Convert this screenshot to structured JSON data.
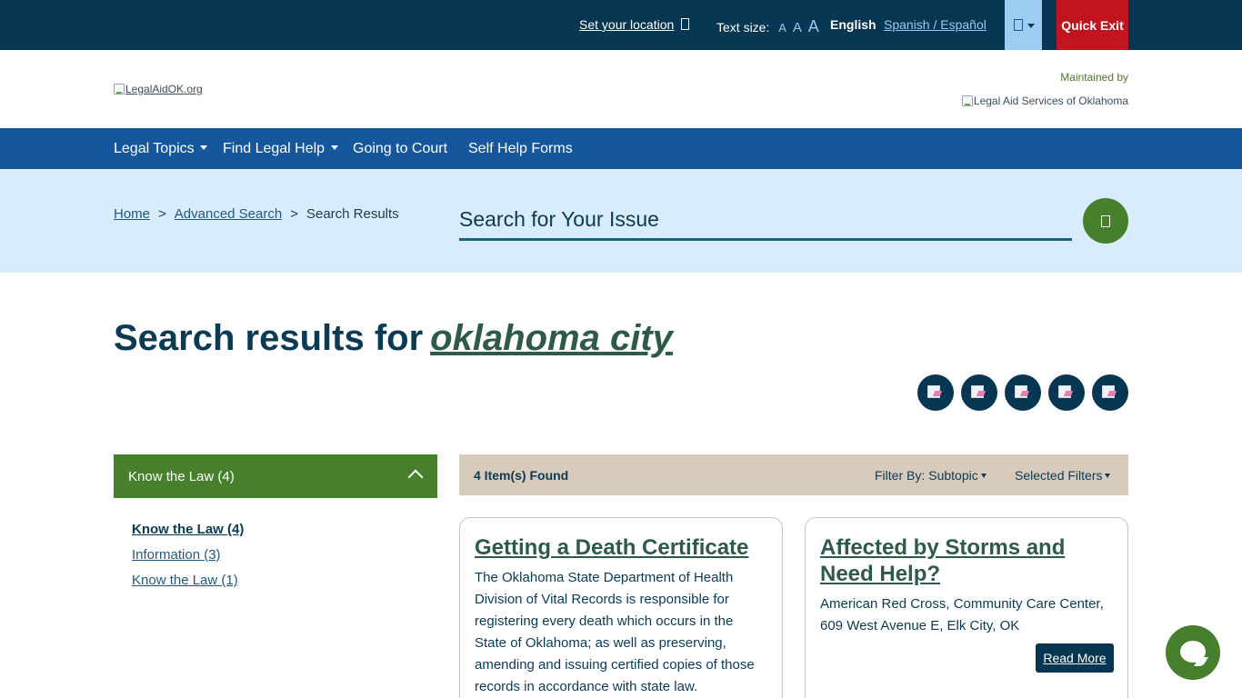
{
  "utility": {
    "location_label": "Set your location",
    "text_size_label": "Text size:",
    "text_size_options": [
      "A",
      "A",
      "A"
    ],
    "lang_current": "English",
    "lang_alt": "Spanish / Español",
    "quick_exit": "Quick Exit"
  },
  "header": {
    "logo_alt": "LegalAidOK.org",
    "maintained_by": "Maintained by",
    "partner_logo_alt": "Legal Aid Services of Oklahoma"
  },
  "nav": {
    "items": [
      {
        "label": "Legal Topics",
        "dropdown": true
      },
      {
        "label": "Find Legal Help",
        "dropdown": true
      },
      {
        "label": "Going to Court",
        "dropdown": false
      },
      {
        "label": "Self Help Forms",
        "dropdown": false
      }
    ]
  },
  "breadcrumb": {
    "home": "Home",
    "advanced": "Advanced Search",
    "current": "Search Results",
    "separator": ">"
  },
  "search": {
    "placeholder": "Search for Your Issue"
  },
  "results": {
    "title_prefix": "Search results for",
    "query": "oklahoma city",
    "found": "4 Item(s) Found",
    "filter_by_label": "Filter By:",
    "filter_by_value": "Subtopic",
    "selected_filters": "Selected Filters"
  },
  "facets": {
    "heading": "Know the Law (4)",
    "items": [
      {
        "label": "Know the Law (4)",
        "active": true
      },
      {
        "label": "Information (3)",
        "active": false
      },
      {
        "label": "Know the Law (1)",
        "active": false
      }
    ]
  },
  "cards": [
    {
      "title": "Getting a Death Certificate",
      "text": "The Oklahoma State Department of Health Division of Vital Records is responsible for registering every death which occurs in the State of Oklahoma; as well as preserving, amending and issuing certified copies of those records in accordance with state law."
    },
    {
      "title": "Affected by Storms and Need Help?",
      "text": "American Red Cross, Community Care Center, 609 West Avenue E, Elk City, OK",
      "button": "Read More"
    }
  ],
  "colors": {
    "utility_bg": "#063651",
    "nav_bg": "#14579d",
    "band_bg": "#d8ecfb",
    "accent_green": "#47802c",
    "quick_exit": "#c0151e",
    "results_bar": "#d8cbbb"
  }
}
